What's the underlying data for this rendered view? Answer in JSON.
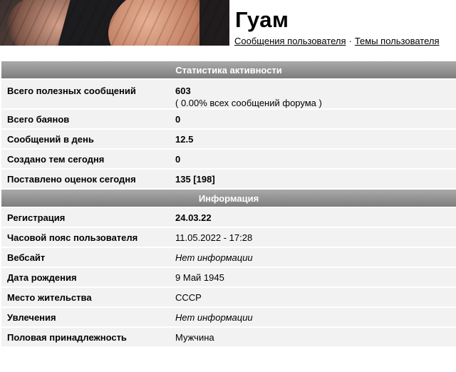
{
  "profile": {
    "username": "Гуам",
    "links": {
      "messages": "Сообщения пользователя",
      "separator": "·",
      "topics": "Темы пользователя"
    }
  },
  "activity": {
    "title": "Статистика активности",
    "rows": [
      {
        "label": "Всего полезных сообщений",
        "value": "603",
        "note": "( 0.00% всех сообщений форума )"
      },
      {
        "label": "Всего баянов",
        "value": "0"
      },
      {
        "label": "Сообщений в день",
        "value": "12.5"
      },
      {
        "label": "Создано тем сегодня",
        "value": "0"
      },
      {
        "label": "Поставлено оценок сегодня",
        "value": "135 [198]"
      }
    ]
  },
  "info": {
    "title": "Информация",
    "rows": [
      {
        "label": "Регистрация",
        "value": "24.03.22"
      },
      {
        "label": "Часовой пояс пользователя",
        "value": "11.05.2022 - 17:28"
      },
      {
        "label": "Вебсайт",
        "value": "Нет информации"
      },
      {
        "label": "Дата рождения",
        "value": "9 Май 1945"
      },
      {
        "label": "Место жительства",
        "value": "СССР"
      },
      {
        "label": "Увлечения",
        "value": "Нет информации"
      },
      {
        "label": "Половая принадлежность",
        "value": "Мужчина"
      }
    ]
  }
}
